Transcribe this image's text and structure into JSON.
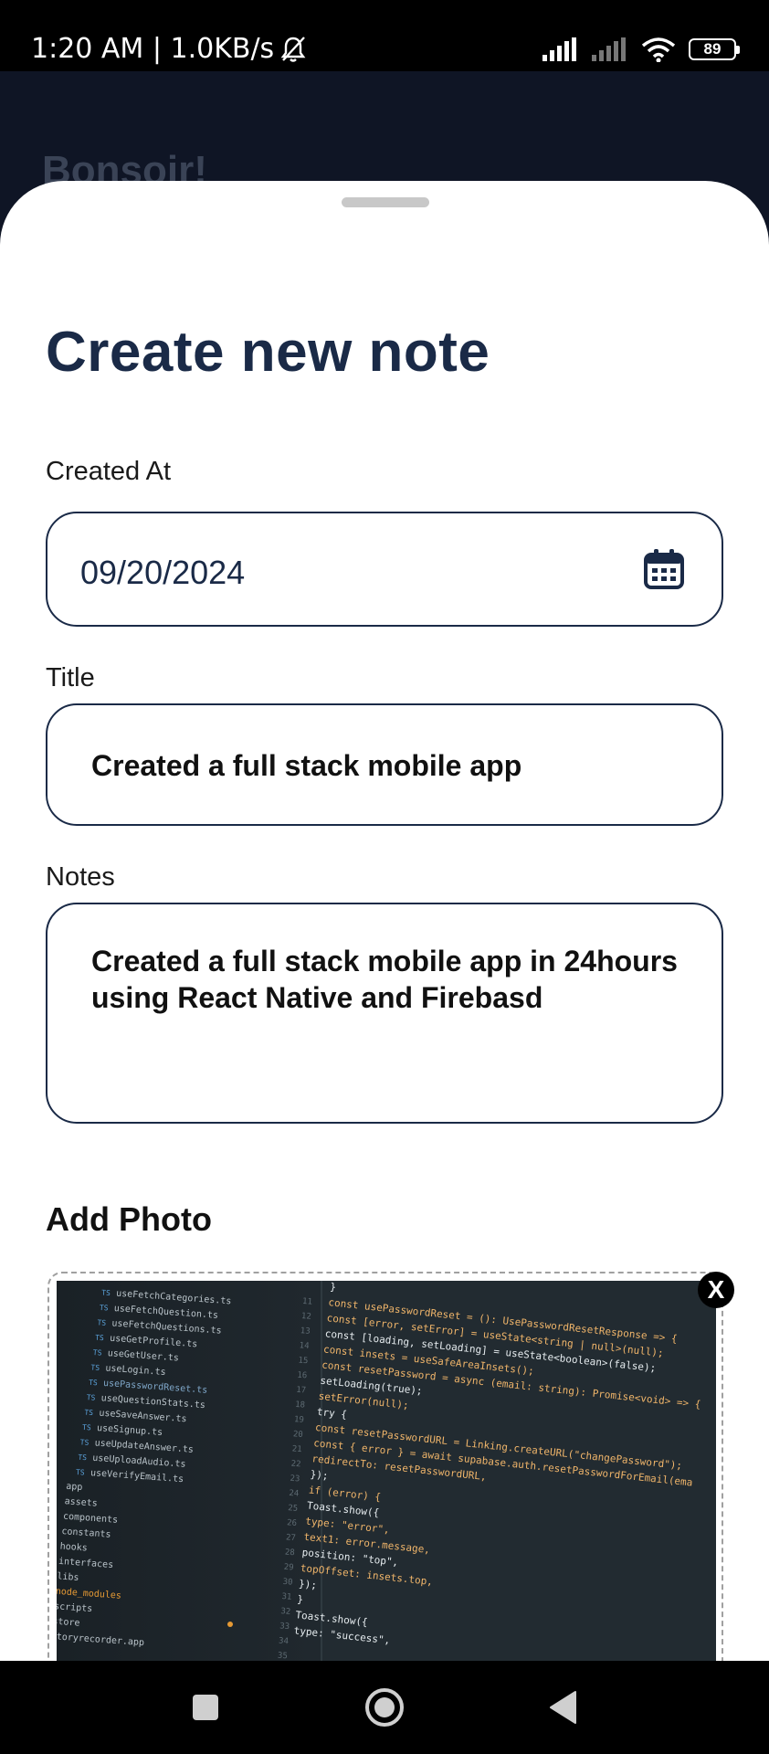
{
  "status_bar": {
    "time_speed": "1:20 AM | 1.0KB/s",
    "battery": "89"
  },
  "background": {
    "greeting": "Bonsoir!"
  },
  "sheet": {
    "title": "Create new note",
    "created_at": {
      "label": "Created At",
      "value": "09/20/2024"
    },
    "title_field": {
      "label": "Title",
      "value": "Created a full stack mobile app"
    },
    "notes_field": {
      "label": "Notes",
      "value": "Created a full stack mobile app in 24hours using React Native and Firebasd"
    },
    "add_photo": {
      "label": "Add Photo",
      "remove_label": "X"
    }
  },
  "photo_code": {
    "files": [
      "useFetchCategories.ts",
      "useFetchQuestion.ts",
      "useFetchQuestions.ts",
      "useGetProfile.ts",
      "useGetUser.ts",
      "useLogin.ts",
      "usePasswordReset.ts",
      "useQuestionStats.ts",
      "useSaveAnswer.ts",
      "useSignup.ts",
      "useUpdateAnswer.ts",
      "useUploadAudio.ts",
      "useVerifyEmail.ts",
      "app",
      "assets",
      "components",
      "constants",
      "hooks",
      "interfaces",
      "libs",
      "node_modules",
      "scripts",
      "store",
      "storyrecorder.app"
    ],
    "code_lines": [
      "}",
      "const usePasswordReset = (): UsePasswordResetResponse => {",
      "  const [error, setError] = useState<string | null>(null);",
      "  const [loading, setLoading] = useState<boolean>(false);",
      "  const insets = useSafeAreaInsets();",
      "  const resetPassword = async (email: string): Promise<void> => {",
      "    setLoading(true);",
      "    setError(null);",
      "    try {",
      "      const resetPasswordURL = Linking.createURL(\"changePassword\");",
      "      const { error } = await supabase.auth.resetPasswordForEmail(ema",
      "        redirectTo: resetPasswordURL,",
      "      });",
      "      if (error) {",
      "        Toast.show({",
      "          type: \"error\",",
      "          text1: error.message,",
      "          position: \"top\",",
      "          topOffset: insets.top,",
      "        });",
      "      }",
      "      Toast.show({",
      "        type: \"success\","
    ]
  }
}
